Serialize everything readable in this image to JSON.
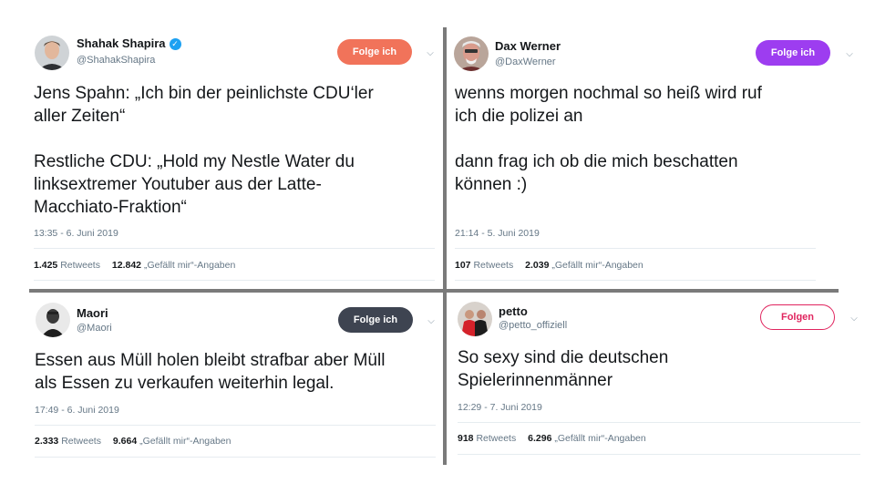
{
  "tweets": [
    {
      "name": "Shahak Shapira",
      "handle": "@ShahakShapira",
      "verified": true,
      "follow_label": "Folge ich",
      "follow_color": "#f1735a",
      "text_1": "Jens Spahn: „Ich bin der peinlichste CDU‘ler\naller Zeiten“",
      "text_2": "Restliche CDU: „Hold my Nestle Water du\nlinksextremer Youtuber aus der Latte-\nMacchiato-Fraktion“",
      "time": "13:35 - 6. Juni 2019",
      "retweets": "1.425",
      "retweets_label": "Retweets",
      "likes": "12.842",
      "likes_label": "„Gefällt mir“-Angaben"
    },
    {
      "name": "Dax Werner",
      "handle": "@DaxWerner",
      "follow_label": "Folge ich",
      "follow_color": "#9d3df0",
      "text_1": "wenns morgen nochmal so heiß wird ruf\nich die polizei an",
      "text_2": "dann frag ich ob die mich beschatten\nkönnen :)",
      "time": "21:14 - 5. Juni 2019",
      "retweets": "107",
      "retweets_label": "Retweets",
      "likes": "2.039",
      "likes_label": "„Gefällt mir“-Angaben"
    },
    {
      "name": "Maori",
      "handle": "@Maori",
      "follow_label": "Folge ich",
      "follow_color": "#3e4451",
      "text_1": "Essen aus Müll holen bleibt strafbar aber Müll\nals Essen zu verkaufen weiterhin legal.",
      "time": "17:49 - 6. Juni 2019",
      "retweets": "2.333",
      "retweets_label": "Retweets",
      "likes": "9.664",
      "likes_label": "„Gefällt mir“-Angaben"
    },
    {
      "name": "petto",
      "handle": "@petto_offiziell",
      "follow_label": "Folgen",
      "follow_color": "#e0245e",
      "text_1": "So sexy sind die deutschen\nSpielerinnenmänner",
      "time": "12:29 - 7. Juni 2019",
      "retweets": "918",
      "retweets_label": "Retweets",
      "likes": "6.296",
      "likes_label": "„Gefällt mir“-Angaben"
    }
  ]
}
